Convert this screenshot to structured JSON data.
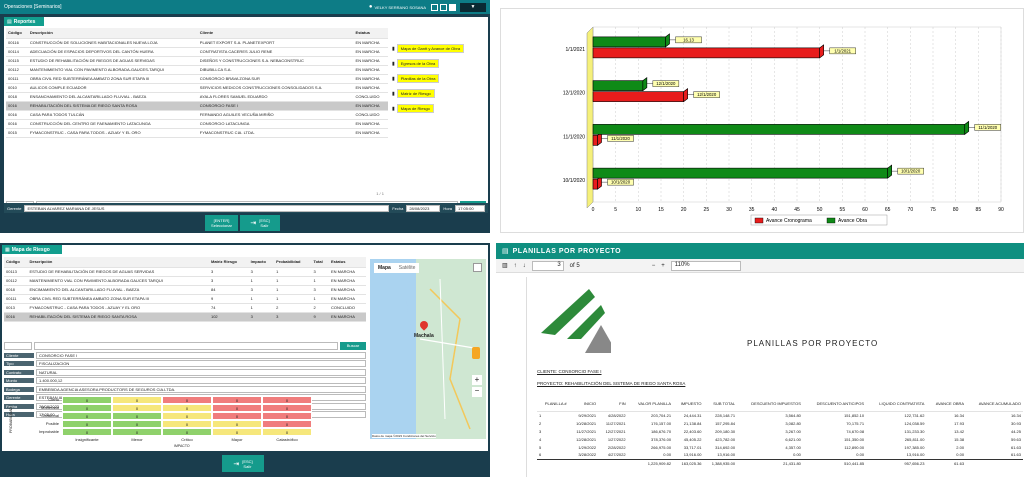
{
  "q1": {
    "app_title": "Operaciones [Seminarios]",
    "user": "VELKY SERRANO SOSANA",
    "panel_title": "Reportes",
    "columns": [
      "Código",
      "Descripción",
      "Cliente",
      "Estatus"
    ],
    "rows": [
      [
        "00116",
        "CONSTRUCCIÓN DE SOLUCIONES HABITACIONALES NUEVA LOJA",
        "PLANET EXPORT S.A. PLANETEXPORT",
        "EN MARCHA"
      ],
      [
        "00114",
        "ADECUACIÓN DE ESPACIOS DEPORTIVOS DEL CANTÓN HUERA",
        "CONTRATISTA CACERES JULIO RENE",
        "EN MARCHA"
      ],
      [
        "00115",
        "ESTUDIO DE REHABILITACIÓN DE RIEGOS DE AGUAS SERVIDAS",
        "DISEÑOS Y CONSTRUCCIONES S.A. NEBACONSTRUC",
        "EN MARCHA"
      ],
      [
        "00112",
        "MANTENIMIENTO VIAL CON PAVIMENTO ALBORADA-GAUCES-TARQUI",
        "DIBUBILLCA S.A.",
        "EN MARCHA"
      ],
      [
        "00111",
        "OBRA CIVIL RED SUBTERRÁNEA AMBATO ZONA SUR ETAPA III",
        "CONSORCIO BRAVA ZONA SUR",
        "EN MARCHA"
      ],
      [
        "0010",
        "AULICOS COMPLE ECUADOR",
        "SERVICIOS MEDICOS CONSTRUCCIONES CONSOLIDADOS S.A.",
        "EN MARCHA"
      ],
      [
        "0018",
        "ENSANCHAMIENTO DEL ALCANTARILLADO FLUVIAL - BAEZA",
        "AYALA FLORES SAMUEL EDUARDO",
        "CONCLUIDO"
      ],
      [
        "0016",
        "REHABILITACIÓN DEL SISTEMA DE RIEGO SANTA ROSA",
        "CONSORCIO FASE I",
        "EN MARCHA"
      ],
      [
        "0016",
        "CASA PARA TODOS TULCÁN",
        "FERNANDO AGUILES VECUÑA MIRIÑO",
        "CONCLUIDO"
      ],
      [
        "0016",
        "CONSTRUCCIÓN DEL CENTRO DE FAENAMIENTO LATACUNGA",
        "CONSORCIO LATACUNGA",
        "EN MARCHA"
      ],
      [
        "0015",
        "FYMACONSTRUC - CASA PARA TODOS - AZUAY Y EL ORO",
        "FYMACONSTRUC CIA. LTDA.",
        "EN MARCHA"
      ]
    ],
    "selected_row": 7,
    "reports": [
      "Mapa de Gantt y Avance de Obra",
      "Egresos de la Obra",
      "Planillas de la Obra",
      "Matriz de Riesgo",
      "Mapa de Riesgo"
    ],
    "filter_value": "=",
    "search_label": "Buscar",
    "pager": "1 / 1",
    "footer_label1": "Gerente",
    "footer_value1": "ESTEBAN ALVAREZ MARIANA DE JESUS",
    "footer_label2": "Fecha",
    "footer_value2": "28/08/2023",
    "footer_label3": "Hora",
    "footer_value3": "17:05:00",
    "btn_select": "[ENTER]\nSeleccionar",
    "btn_exit": "[ESC]\nSalir"
  },
  "q2": {
    "chart_data": {
      "type": "bar",
      "orientation": "horizontal",
      "categories": [
        "1/1/2021",
        "12/1/2020",
        "11/1/2020",
        "10/1/2020"
      ],
      "series": [
        {
          "name": "Avance Cronograma",
          "color": "#e81c1c",
          "values": [
            {
              "category": "1/1/2021",
              "value": 50,
              "label": "1/1/2021"
            },
            {
              "category": "12/1/2020",
              "value": 20,
              "label": "12/1/2020"
            },
            {
              "category": "11/1/2020",
              "value": 1,
              "label": "11/1/2020"
            },
            {
              "category": "10/1/2020",
              "value": 1,
              "label": "10/1/2020"
            }
          ]
        },
        {
          "name": "Avance Obra",
          "color": "#0f8a17",
          "values": [
            {
              "category": "1/1/2021",
              "value": 16,
              "label": "16.13"
            },
            {
              "category": "12/1/2020",
              "value": 11,
              "label": "12/1/2020"
            },
            {
              "category": "11/1/2020",
              "value": 82,
              "label": "11/1/2020"
            },
            {
              "category": "10/1/2020",
              "value": 65,
              "label": "10/1/2020"
            }
          ]
        }
      ],
      "xlim": [
        0,
        90
      ],
      "ticks": [
        0,
        5,
        10,
        15,
        20,
        25,
        30,
        35,
        40,
        45,
        50,
        55,
        60,
        65,
        70,
        75,
        80,
        85,
        90
      ]
    }
  },
  "q3": {
    "title": "Mapa de Riesgo",
    "columns": [
      "Código",
      "Descripción",
      "Matriz Riesgo",
      "Impacto",
      "Probabilidad",
      "Total",
      "Estatus"
    ],
    "rows": [
      [
        "00113",
        "ESTUDIO DE REHABILITACIÓN DE RIEGOS DE AGUAS SERVIDAS",
        "3",
        "3",
        "1",
        "3",
        "EN MARCHA"
      ],
      [
        "00112",
        "MANTENIMIENTO VIAL CON PAVIMENTO ALBORADA GAUCES TARQUI",
        "3",
        "1",
        "1",
        "1",
        "EN MARCHA"
      ],
      [
        "0018",
        "ENCIMAMIENTO DEL ALCANTARILLADO FLUVIAL - BAEZA",
        "84",
        "3",
        "1",
        "3",
        "EN MARCHA"
      ],
      [
        "00111",
        "OBRA CIVIL RED SUBTERRÁNEA AMBATO ZONA SUR ETAPA III",
        "9",
        "1",
        "1",
        "1",
        "EN MARCHA"
      ],
      [
        "0013",
        "FYMACONSTRUC - CASA PARA TODOS - AZUAY Y EL ORO",
        "74",
        "1",
        "2",
        "2",
        "CONCLUIDO"
      ],
      [
        "0016",
        "REHABILITACIÓN DEL SISTEMA DE RIEGO SANTA ROSA",
        "102",
        "3",
        "3",
        "9",
        "EN MARCHA"
      ]
    ],
    "selected_row": 5,
    "search_label": "Buscar",
    "map_tab1": "Mapa",
    "map_tab2": "Satélite",
    "map_city": "Machala",
    "map_attr": "Datos de mapa ©2023   Condiciones del Servicio",
    "info": [
      {
        "label": "Cliente",
        "value": "CONSORCIO FASE I"
      },
      {
        "label": "Tipo",
        "value": "FISCALIZACION"
      },
      {
        "label": "Contrato",
        "value": "NATURAL"
      },
      {
        "label": "Monto",
        "value": "1.400.000,12"
      },
      {
        "label": "Bodega",
        "value": "EMBEBIDA AGENCIA ASESORA PRODUCTORS DE SEGUROS CIA.LTDA."
      },
      {
        "label": "Gerente",
        "value": "ESTEBAN ALVAREZ MARIANA DE JESUS"
      },
      {
        "label": "Fecha",
        "value": "28/08/2023"
      },
      {
        "label": "Hora",
        "value": "17:05:00"
      }
    ],
    "matrix_rows": [
      "Cierto",
      "Moderado",
      "Ocasional",
      "Posible",
      "Improbable"
    ],
    "matrix_cols": [
      "Insignificante",
      "Menor",
      "Crítico",
      "Mayor",
      "Catastrófico"
    ],
    "matrix_colors": [
      [
        "#8fd16b",
        "#f6e77b",
        "#f07d7d",
        "#f07d7d",
        "#f07d7d"
      ],
      [
        "#8fd16b",
        "#f6e77b",
        "#f6e77b",
        "#f07d7d",
        "#f07d7d"
      ],
      [
        "#8fd16b",
        "#8fd16b",
        "#f6e77b",
        "#f07d7d",
        "#f07d7d"
      ],
      [
        "#8fd16b",
        "#8fd16b",
        "#f6e77b",
        "#f6e77b",
        "#f07d7d"
      ],
      [
        "#8fd16b",
        "#8fd16b",
        "#8fd16b",
        "#f6e77b",
        "#f6e77b"
      ]
    ],
    "matrix_values": [
      [
        "0",
        "0",
        "0",
        "0",
        "0"
      ],
      [
        "0",
        "0",
        "0",
        "0",
        "0"
      ],
      [
        "0",
        "0",
        "0",
        "0",
        "0"
      ],
      [
        "0",
        "0",
        "0",
        "0",
        "0"
      ],
      [
        "0",
        "0",
        "0",
        "0",
        "0"
      ]
    ],
    "y_axis": "PROBABILIDAD",
    "x_axis": "IMPACTO",
    "btn_exit": "[ESC]\nSalir"
  },
  "q4": {
    "title": "PLANILLAS POR PROYECTO",
    "page": "3",
    "of": "of 5",
    "zoom": "110%",
    "doc_title": "PLANILLAS POR PROYECTO",
    "client": "CLIENTE: CONSORCIO FASE I",
    "project": "PROYECTO: REHABILITACIÓN DEL SISTEMA DE RIEGO SANTA ROSA",
    "columns": [
      "PLANILLA #",
      "INICIO",
      "FIN",
      "VALOR PLANILLA",
      "IMPUESTO",
      "SUB TOTAL",
      "DESCUENTO IMPUESTOS",
      "DESCUENTO ANTICIPOS",
      "LIQUIDO CONTRATISTA",
      "AVANCE OBRA",
      "AVANCE ACUMULADO"
    ],
    "rows": [
      [
        "1",
        "9/29/2021",
        "4/28/2022",
        "203,704.21",
        "24,444.31",
        "228,148.71",
        "3,564.80",
        "151,852.10",
        "122,731.62",
        "16.34",
        "16.34"
      ],
      [
        "2",
        "10/28/2021",
        "11/27/2021",
        "176,157.00",
        "21,138.84",
        "157,295.84",
        "3,082.80",
        "70,175.71",
        "124,038.59",
        "17.93",
        "30.93"
      ],
      [
        "3",
        "11/27/2021",
        "12/27/2021",
        "186,676.70",
        "22,403.60",
        "209,180.30",
        "3,267.00",
        "74,670.08",
        "131,233.30",
        "13.42",
        "44.25"
      ],
      [
        "4",
        "12/28/2021",
        "1/27/2022",
        "378,376.00",
        "45,405.22",
        "423,782.00",
        "6,621.00",
        "151,350.00",
        "265,811.00",
        "15.38",
        "59.63"
      ],
      [
        "5",
        "1/29/2022",
        "2/28/2022",
        "266,975.00",
        "33,717.01",
        "314,692.00",
        "4,357.00",
        "112,890.00",
        "197,385.00",
        "2.00",
        "61.63"
      ],
      [
        "6",
        "3/28/2022",
        "4/27/2022",
        "0.00",
        "13,916.00",
        "13,916.00",
        "0.00",
        "0.00",
        "13,916.00",
        "0.00",
        "61.63"
      ]
    ],
    "totals": [
      "",
      "",
      "",
      "1,225,909.82",
      "163,025.36",
      "1,388,935.00",
      "21,431.80",
      "510,441.85",
      "957,656.23",
      "61.63",
      ""
    ]
  }
}
